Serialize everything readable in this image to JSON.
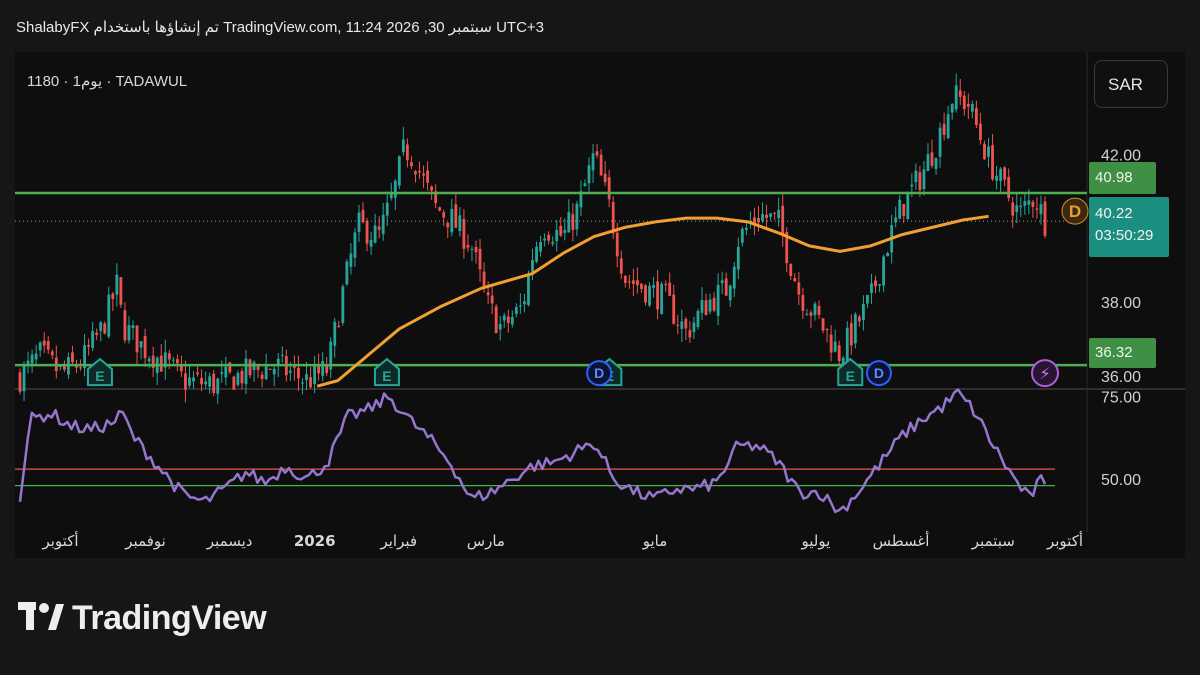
{
  "header": {
    "text": "ShalabyFX تم إنشاؤها باستخدام TradingView.com, 11:24 2026 ,30 سبتمبر UTC+3"
  },
  "symbol_info": "1180 · يوم1 · TADAWUL",
  "currency": "SAR",
  "tags": {
    "upper_line": "40.98",
    "lower_line": "36.32",
    "current_price": "40.22",
    "countdown": "03:50:29"
  },
  "markers": {
    "earnings": "E",
    "dividend": "D",
    "dividend_future": "D",
    "flash": "⚡"
  },
  "logo": {
    "text": "TradingView"
  },
  "colors": {
    "up": "#26a69a",
    "down": "#ef5350",
    "ma": "#f0a032",
    "rsi": "#9575cd",
    "hline": "#4caf50",
    "rsi_upper_band": "#ef5350",
    "rsi_lower_band": "#4caf50"
  },
  "chart_data": {
    "type": "candlestick",
    "price_axis": {
      "min": 35.7,
      "max": 44.8,
      "ticks": [
        "42.00",
        "38.00",
        "36.00"
      ]
    },
    "time_axis": [
      "أكتوبر",
      "نوفمبر",
      "ديسمبر",
      "2026",
      "فبراير",
      "مارس",
      "مايو",
      "يوليو",
      "أغسطس",
      "سبتمبر",
      "أكتوبر"
    ],
    "horizontal_levels": [
      40.98,
      36.32
    ],
    "last_close": 40.22,
    "ma_points": [
      [
        0.29,
        35.75
      ],
      [
        0.31,
        35.9
      ],
      [
        0.34,
        36.6
      ],
      [
        0.37,
        37.3
      ],
      [
        0.41,
        37.9
      ],
      [
        0.45,
        38.4
      ],
      [
        0.5,
        38.8
      ],
      [
        0.53,
        39.35
      ],
      [
        0.56,
        39.8
      ],
      [
        0.59,
        40.05
      ],
      [
        0.62,
        40.2
      ],
      [
        0.65,
        40.3
      ],
      [
        0.68,
        40.3
      ],
      [
        0.71,
        40.2
      ],
      [
        0.74,
        39.9
      ],
      [
        0.77,
        39.55
      ],
      [
        0.8,
        39.4
      ],
      [
        0.83,
        39.55
      ],
      [
        0.86,
        39.85
      ],
      [
        0.89,
        40.05
      ],
      [
        0.92,
        40.25
      ],
      [
        0.945,
        40.35
      ]
    ],
    "close_points": [
      [
        0.0,
        36.0
      ],
      [
        0.02,
        36.6
      ],
      [
        0.04,
        36.1
      ],
      [
        0.06,
        36.4
      ],
      [
        0.08,
        37.3
      ],
      [
        0.095,
        38.5
      ],
      [
        0.1,
        37.4
      ],
      [
        0.12,
        36.8
      ],
      [
        0.14,
        36.4
      ],
      [
        0.16,
        35.9
      ],
      [
        0.19,
        35.8
      ],
      [
        0.22,
        36.1
      ],
      [
        0.25,
        36.3
      ],
      [
        0.28,
        35.9
      ],
      [
        0.3,
        36.2
      ],
      [
        0.315,
        38.3
      ],
      [
        0.33,
        40.1
      ],
      [
        0.35,
        39.8
      ],
      [
        0.365,
        41.0
      ],
      [
        0.375,
        42.2
      ],
      [
        0.385,
        41.9
      ],
      [
        0.395,
        41.2
      ],
      [
        0.405,
        40.6
      ],
      [
        0.42,
        40.3
      ],
      [
        0.44,
        39.6
      ],
      [
        0.455,
        38.0
      ],
      [
        0.47,
        37.3
      ],
      [
        0.49,
        37.9
      ],
      [
        0.5,
        39.3
      ],
      [
        0.51,
        40.1
      ],
      [
        0.53,
        39.8
      ],
      [
        0.545,
        40.6
      ],
      [
        0.56,
        42.0
      ],
      [
        0.575,
        40.6
      ],
      [
        0.59,
        38.7
      ],
      [
        0.61,
        38.4
      ],
      [
        0.63,
        38.1
      ],
      [
        0.65,
        37.2
      ],
      [
        0.67,
        38.0
      ],
      [
        0.69,
        38.4
      ],
      [
        0.7,
        39.7
      ],
      [
        0.72,
        40.4
      ],
      [
        0.74,
        40.2
      ],
      [
        0.76,
        38.3
      ],
      [
        0.78,
        37.5
      ],
      [
        0.8,
        36.6
      ],
      [
        0.81,
        37.1
      ],
      [
        0.83,
        38.1
      ],
      [
        0.845,
        39.5
      ],
      [
        0.86,
        40.6
      ],
      [
        0.88,
        41.5
      ],
      [
        0.895,
        42.4
      ],
      [
        0.91,
        43.6
      ],
      [
        0.925,
        43.4
      ],
      [
        0.945,
        41.9
      ],
      [
        0.96,
        41.1
      ],
      [
        0.975,
        40.4
      ],
      [
        0.99,
        40.9
      ],
      [
        1.0,
        40.22
      ]
    ],
    "rsi": {
      "axis_ticks": [
        "75.00",
        "50.00"
      ],
      "axis_min": 40,
      "axis_max": 77,
      "upper_band": 53,
      "lower_band": 48,
      "points": [
        [
          0.0,
          45
        ],
        [
          0.01,
          68
        ],
        [
          0.03,
          70
        ],
        [
          0.05,
          66
        ],
        [
          0.07,
          65
        ],
        [
          0.09,
          67
        ],
        [
          0.1,
          70
        ],
        [
          0.11,
          63
        ],
        [
          0.14,
          52
        ],
        [
          0.16,
          45
        ],
        [
          0.18,
          43
        ],
        [
          0.2,
          47
        ],
        [
          0.22,
          52
        ],
        [
          0.24,
          49
        ],
        [
          0.26,
          54
        ],
        [
          0.28,
          50
        ],
        [
          0.3,
          55
        ],
        [
          0.32,
          69
        ],
        [
          0.34,
          71
        ],
        [
          0.36,
          75
        ],
        [
          0.38,
          68
        ],
        [
          0.4,
          62
        ],
        [
          0.42,
          55
        ],
        [
          0.44,
          44
        ],
        [
          0.46,
          46
        ],
        [
          0.48,
          50
        ],
        [
          0.5,
          54
        ],
        [
          0.52,
          55
        ],
        [
          0.54,
          58
        ],
        [
          0.56,
          61
        ],
        [
          0.58,
          50
        ],
        [
          0.6,
          46
        ],
        [
          0.62,
          44
        ],
        [
          0.64,
          47
        ],
        [
          0.66,
          47
        ],
        [
          0.68,
          49
        ],
        [
          0.7,
          60
        ],
        [
          0.72,
          60
        ],
        [
          0.74,
          55
        ],
        [
          0.76,
          46
        ],
        [
          0.78,
          46
        ],
        [
          0.8,
          40
        ],
        [
          0.82,
          47
        ],
        [
          0.84,
          55
        ],
        [
          0.86,
          63
        ],
        [
          0.88,
          68
        ],
        [
          0.9,
          72
        ],
        [
          0.915,
          76
        ],
        [
          0.93,
          71
        ],
        [
          0.95,
          60
        ],
        [
          0.97,
          50
        ],
        [
          0.985,
          44
        ],
        [
          0.995,
          50
        ],
        [
          1.0,
          47
        ]
      ]
    }
  }
}
